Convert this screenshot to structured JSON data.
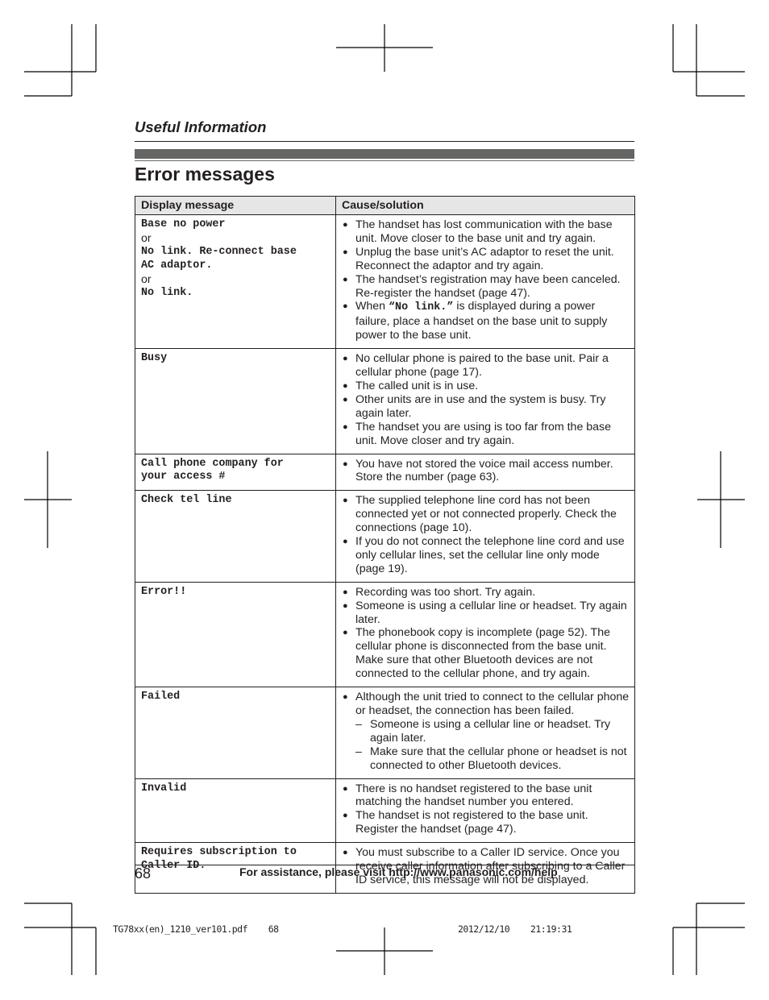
{
  "header": {
    "section_title": "Useful Information",
    "page_title": "Error messages"
  },
  "table": {
    "columns": [
      "Display message",
      "Cause/solution"
    ],
    "rows": [
      {
        "message_lines": [
          "Base no power",
          "or",
          "No link. Re-connect base",
          "AC adaptor.",
          "or",
          "No link."
        ],
        "causes": [
          "The handset has lost communication with the base unit. Move closer to the base unit and try again.",
          "Unplug the base unit’s AC adaptor to reset the unit. Reconnect the adaptor and try again.",
          "The handset’s registration may have been canceled. Re-register the handset (page 47).",
          {
            "prefix": "When ",
            "code": "“No link.”",
            "suffix": " is displayed during a power failure, place a handset on the base unit to supply power to the base unit."
          }
        ]
      },
      {
        "message_lines": [
          "Busy"
        ],
        "causes": [
          "No cellular phone is paired to the base unit. Pair a cellular phone (page 17).",
          "The called unit is in use.",
          "Other units are in use and the system is busy. Try again later.",
          "The handset you are using is too far from the base unit. Move closer and try again."
        ]
      },
      {
        "message_lines": [
          "Call phone company for",
          "your access #"
        ],
        "causes": [
          "You have not stored the voice mail access number. Store the number (page 63)."
        ]
      },
      {
        "message_lines": [
          "Check tel line"
        ],
        "causes": [
          "The supplied telephone line cord has not been connected yet or not connected properly. Check the connections (page 10).",
          "If you do not connect the telephone line cord and use only cellular lines, set the cellular line only mode (page 19)."
        ]
      },
      {
        "message_lines": [
          "Error!!"
        ],
        "causes": [
          "Recording was too short. Try again.",
          "Someone is using a cellular line or headset. Try again later.",
          "The phonebook copy is incomplete (page 52). The cellular phone is disconnected from the base unit. Make sure that other Bluetooth devices are not connected to the cellular phone, and try again."
        ]
      },
      {
        "message_lines": [
          "Failed"
        ],
        "causes": [
          "Although the unit tried to connect to the cellular phone or headset, the connection has been failed."
        ],
        "sub_causes": [
          "Someone is using a cellular line or headset. Try again later.",
          "Make sure that the cellular phone or headset is not connected to other Bluetooth devices."
        ]
      },
      {
        "message_lines": [
          "Invalid"
        ],
        "causes": [
          "There is no handset registered to the base unit matching the handset number you entered.",
          "The handset is not registered to the base unit. Register the handset (page 47)."
        ]
      },
      {
        "message_lines": [
          "Requires subscription to",
          "Caller ID."
        ],
        "causes": [
          "You must subscribe to a Caller ID service. Once you receive caller information after subscribing to a Caller ID service, this message will not be displayed."
        ]
      }
    ]
  },
  "footer": {
    "page_number": "68",
    "assistance": "For assistance, please visit http://www.panasonic.com/help",
    "print_file": "TG78xx(en)_1210_ver101.pdf    68",
    "print_datetime": "2012/12/10    21:19:31"
  },
  "colors": {
    "text": "#231f20",
    "header_bar": "#666563",
    "table_header_bg": "#e6e6e6"
  }
}
